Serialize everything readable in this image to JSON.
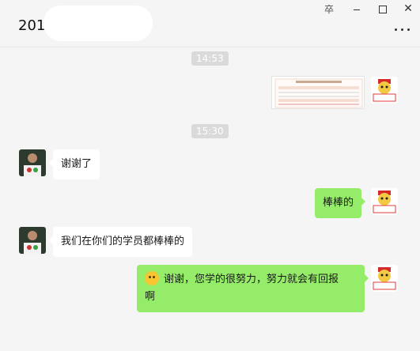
{
  "window": {
    "title": "201",
    "pin_glyph": "卒",
    "close_glyph": "✕"
  },
  "colors": {
    "background": "#f5f5f5",
    "self_bubble": "#95ec69",
    "other_bubble": "#ffffff",
    "timestamp_bg": "#dadada"
  },
  "messages": [
    {
      "type": "timestamp",
      "text": "14:53"
    },
    {
      "type": "image",
      "sender": "self",
      "alt": "score-report-thumbnail"
    },
    {
      "type": "timestamp",
      "text": "15:30"
    },
    {
      "type": "text",
      "sender": "other",
      "text": "谢谢了"
    },
    {
      "type": "text",
      "sender": "self",
      "text": "棒棒的"
    },
    {
      "type": "text",
      "sender": "other",
      "text": "我们在你们的学员都棒棒的"
    },
    {
      "type": "text",
      "sender": "self",
      "emoji": "thinking-emoji",
      "line1": "谢谢，您学的很努力，努力就会有回报",
      "line2": "啊"
    }
  ]
}
